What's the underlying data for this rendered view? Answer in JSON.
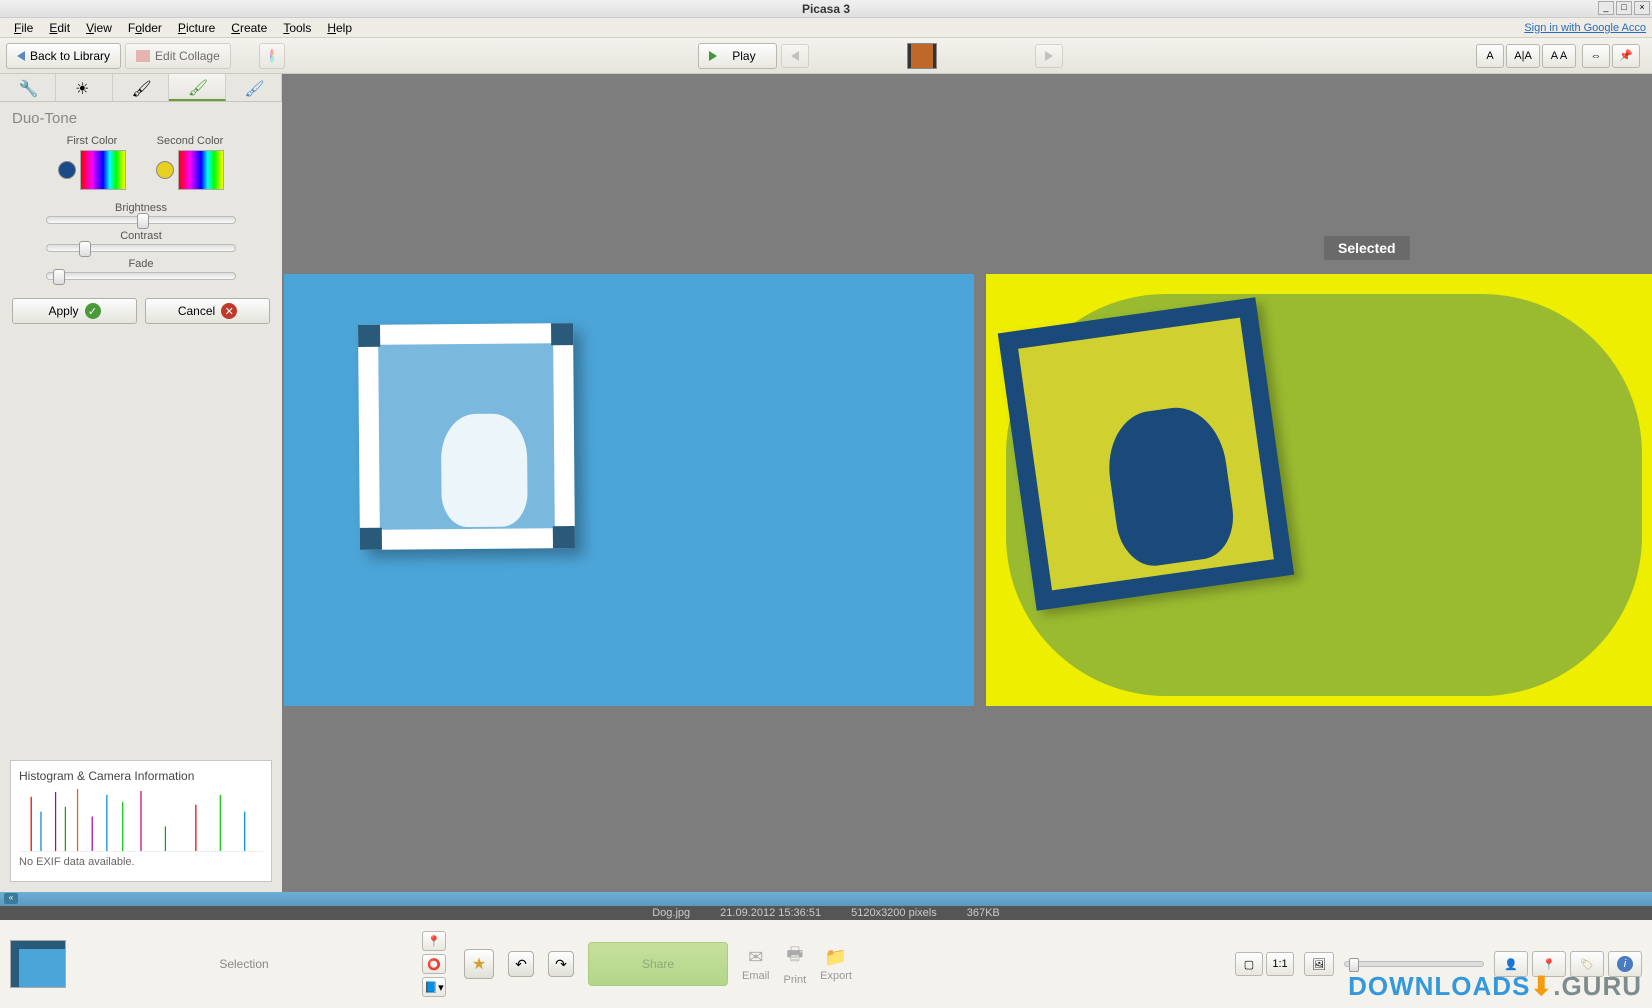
{
  "titlebar": {
    "title": "Picasa 3"
  },
  "menu": {
    "file": "File",
    "edit": "Edit",
    "view": "View",
    "folder": "Folder",
    "picture": "Picture",
    "create": "Create",
    "tools": "Tools",
    "help": "Help",
    "signin": "Sign in with Google Acco"
  },
  "toolbar": {
    "back": "Back to Library",
    "editCollage": "Edit Collage",
    "play": "Play"
  },
  "tabs": {
    "labels": [
      "wrench",
      "sun",
      "brush1",
      "brush-green",
      "brush-blue"
    ]
  },
  "effect": {
    "title": "Duo-Tone",
    "firstColor": {
      "label": "First Color",
      "hex": "#1a4a8a"
    },
    "secondColor": {
      "label": "Second Color",
      "hex": "#e8d020"
    },
    "brightness": {
      "label": "Brightness",
      "pct": 48
    },
    "contrast": {
      "label": "Contrast",
      "pct": 17
    },
    "fade": {
      "label": "Fade",
      "pct": 3
    },
    "apply": "Apply",
    "cancel": "Cancel"
  },
  "histogram": {
    "title": "Histogram & Camera Information",
    "note": "No EXIF data available."
  },
  "canvas": {
    "selected": "Selected"
  },
  "status": {
    "filename": "Dog.jpg",
    "datetime": "21.09.2012 15:36:51",
    "dims": "5120x3200 pixels",
    "size": "367KB"
  },
  "bottom": {
    "selection": "Selection",
    "share": "Share",
    "email": "Email",
    "print": "Print",
    "export": "Export"
  },
  "watermark": {
    "part1": "DOWNLOADS",
    "part2": ".GURU"
  }
}
